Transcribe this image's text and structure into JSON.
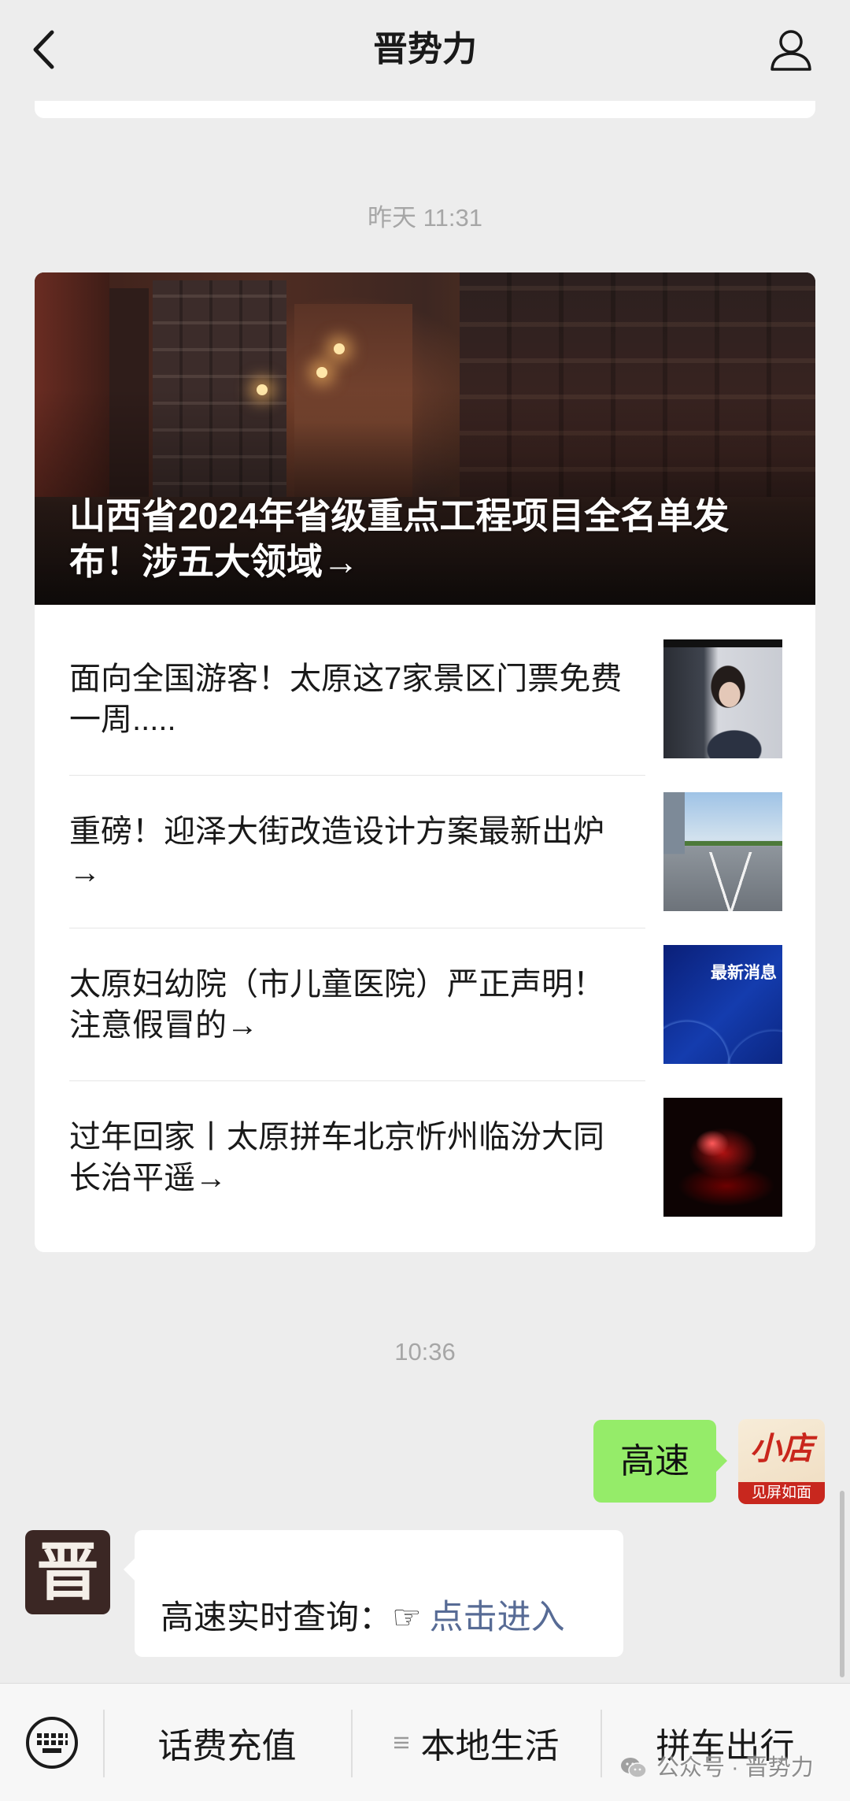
{
  "nav": {
    "title": "晋势力",
    "back_icon": "chevron-left-icon",
    "profile_icon": "user-icon"
  },
  "timestamps": [
    "昨天 11:31",
    "10:36"
  ],
  "article_card": {
    "cover_headline": "山西省2024年省级重点工程项目全名单发布！涉五大领域→",
    "items": [
      {
        "title": "面向全国游客！太原这7家景区门票免费一周....."
      },
      {
        "title": "重磅！迎泽大街改造设计方案最新出炉→"
      },
      {
        "title": "太原妇幼院（市儿童医院）严正声明！注意假冒的→",
        "thumb_caption": "最新消息"
      },
      {
        "title": "过年回家丨太原拼车北京忻州临汾大同长治平遥→"
      }
    ]
  },
  "messages": {
    "sent": {
      "text": "高速",
      "avatar_logo": "小店",
      "avatar_slogan": "见屏如面"
    },
    "received": {
      "avatar_text": "晋",
      "prefix": "高速实时查询：",
      "pointer": "☞",
      "link": "点击进入"
    }
  },
  "bottom_menu": {
    "keyboard_icon": "keyboard-icon",
    "items": [
      {
        "label": "话费充值"
      },
      {
        "label": "本地生活",
        "icon": "menu-lines-icon"
      },
      {
        "label": "拼车出行"
      }
    ]
  },
  "watermark": {
    "icon": "wechat-icon",
    "text": "公众号 · 晋势力"
  },
  "colors": {
    "background": "#ededed",
    "sent_bubble": "#95ec69",
    "link": "#576b95",
    "bottom_bar": "#f7f7f7"
  }
}
